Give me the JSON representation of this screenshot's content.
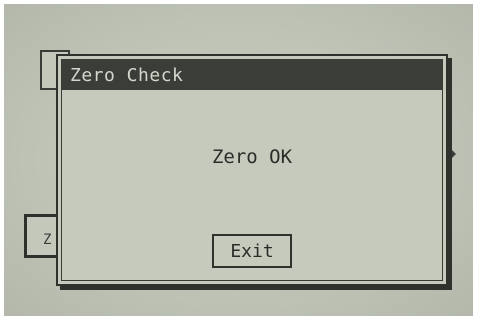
{
  "background": {
    "left_box_label": "Z"
  },
  "dialog": {
    "title": "Zero Check",
    "message": "Zero OK",
    "exit_label": "Exit"
  }
}
